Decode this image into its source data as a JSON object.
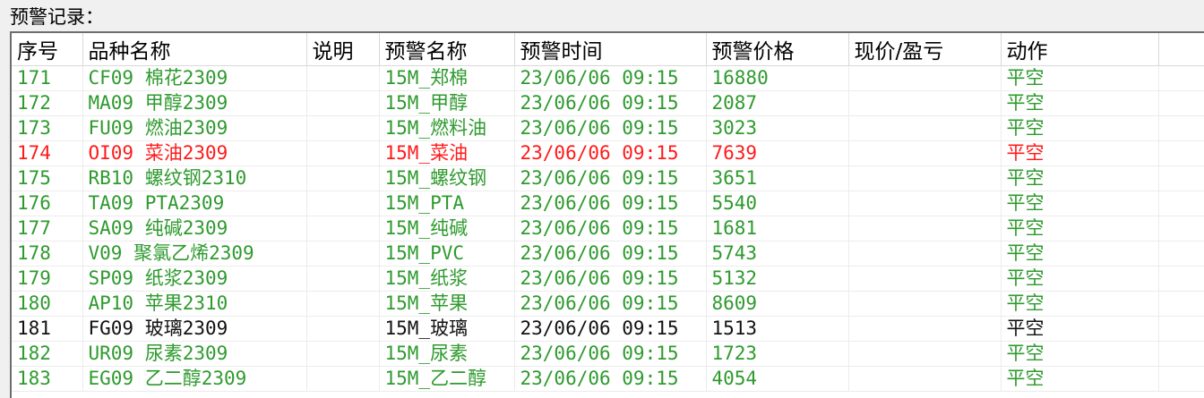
{
  "panel": {
    "title": "预警记录："
  },
  "colors": {
    "green": "#2e9a2e",
    "red": "#ff1a1a",
    "black": "#111111"
  },
  "table": {
    "columns": [
      "序号",
      "品种名称",
      "说明",
      "预警名称",
      "预警时间",
      "预警价格",
      "现价/盈亏",
      "动作"
    ],
    "rows": [
      {
        "id": "171",
        "name": "CF09 棉花2309",
        "note": "",
        "alert": "15M_郑棉",
        "time": "23/06/06 09:15",
        "price": "16880",
        "pnl": "",
        "action": "平空",
        "color": "green"
      },
      {
        "id": "172",
        "name": "MA09 甲醇2309",
        "note": "",
        "alert": "15M_甲醇",
        "time": "23/06/06 09:15",
        "price": "2087",
        "pnl": "",
        "action": "平空",
        "color": "green"
      },
      {
        "id": "173",
        "name": "FU09 燃油2309",
        "note": "",
        "alert": "15M_燃料油",
        "time": "23/06/06 09:15",
        "price": "3023",
        "pnl": "",
        "action": "平空",
        "color": "green"
      },
      {
        "id": "174",
        "name": "OI09 菜油2309",
        "note": "",
        "alert": "15M_菜油",
        "time": "23/06/06 09:15",
        "price": "7639",
        "pnl": "",
        "action": "平空",
        "color": "red"
      },
      {
        "id": "175",
        "name": "RB10 螺纹钢2310",
        "note": "",
        "alert": "15M_螺纹钢",
        "time": "23/06/06 09:15",
        "price": "3651",
        "pnl": "",
        "action": "平空",
        "color": "green"
      },
      {
        "id": "176",
        "name": "TA09 PTA2309",
        "note": "",
        "alert": "15M_PTA",
        "time": "23/06/06 09:15",
        "price": "5540",
        "pnl": "",
        "action": "平空",
        "color": "green"
      },
      {
        "id": "177",
        "name": "SA09 纯碱2309",
        "note": "",
        "alert": "15M_纯碱",
        "time": "23/06/06 09:15",
        "price": "1681",
        "pnl": "",
        "action": "平空",
        "color": "green"
      },
      {
        "id": "178",
        "name": "V09 聚氯乙烯2309",
        "note": "",
        "alert": "15M_PVC",
        "time": "23/06/06 09:15",
        "price": "5743",
        "pnl": "",
        "action": "平空",
        "color": "green"
      },
      {
        "id": "179",
        "name": "SP09 纸浆2309",
        "note": "",
        "alert": "15M_纸浆",
        "time": "23/06/06 09:15",
        "price": "5132",
        "pnl": "",
        "action": "平空",
        "color": "green"
      },
      {
        "id": "180",
        "name": "AP10 苹果2310",
        "note": "",
        "alert": "15M_苹果",
        "time": "23/06/06 09:15",
        "price": "8609",
        "pnl": "",
        "action": "平空",
        "color": "green"
      },
      {
        "id": "181",
        "name": "FG09 玻璃2309",
        "note": "",
        "alert": "15M_玻璃",
        "time": "23/06/06 09:15",
        "price": "1513",
        "pnl": "",
        "action": "平空",
        "color": "black"
      },
      {
        "id": "182",
        "name": "UR09 尿素2309",
        "note": "",
        "alert": "15M_尿素",
        "time": "23/06/06 09:15",
        "price": "1723",
        "pnl": "",
        "action": "平空",
        "color": "green"
      },
      {
        "id": "183",
        "name": "EG09 乙二醇2309",
        "note": "",
        "alert": "15M_乙二醇",
        "time": "23/06/06 09:15",
        "price": "4054",
        "pnl": "",
        "action": "平空",
        "color": "green"
      }
    ]
  }
}
